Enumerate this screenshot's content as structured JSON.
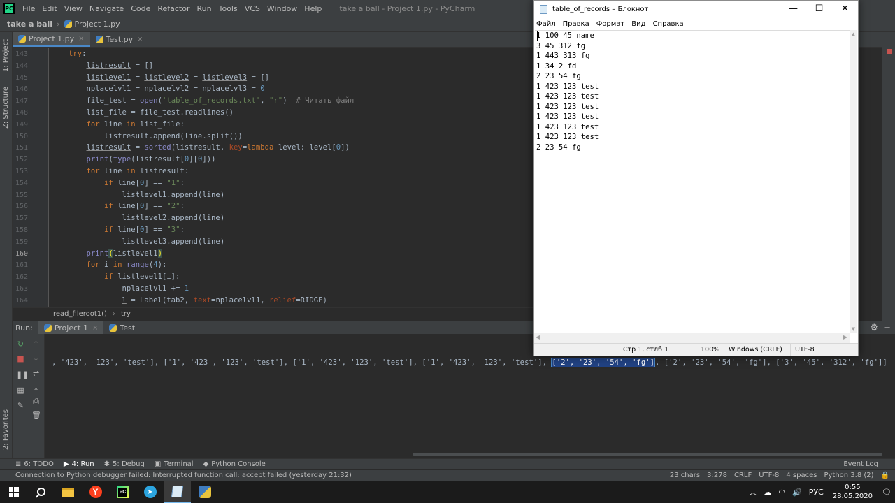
{
  "ide": {
    "logo": "PC",
    "menu": [
      "File",
      "Edit",
      "View",
      "Navigate",
      "Code",
      "Refactor",
      "Run",
      "Tools",
      "VCS",
      "Window",
      "Help"
    ],
    "window_title": "take a ball - Project 1.py - PyCharm",
    "breadcrumb": {
      "project": "take a ball",
      "file": "Project 1.py"
    },
    "tabs": [
      {
        "label": "Project 1.py",
        "close": "×"
      },
      {
        "label": "Test.py",
        "close": "×"
      }
    ],
    "side_labels": {
      "project": "1: Project",
      "structure": "Z: Structure",
      "favorites": "2: Favorites"
    },
    "code_breadcrumb": {
      "func": "read_fileroot1()",
      "block": "try"
    }
  },
  "code_lines": [
    {
      "n": "143",
      "indent": 0,
      "html": "<span class=\"kw\">try</span>:"
    },
    {
      "n": "144",
      "indent": 1,
      "html": "<span class=\"ul\">listresult</span> = []"
    },
    {
      "n": "145",
      "indent": 1,
      "html": "<span class=\"ul\">listlevel1</span> = <span class=\"ul\">listlevel2</span> = <span class=\"ul\">listlevel3</span> = []"
    },
    {
      "n": "146",
      "indent": 1,
      "html": "<span class=\"ul\">nplacelvl1</span> = <span class=\"ul\">nplacelvl2</span> = <span class=\"ul\">nplacelvl3</span> = <span class=\"nm\">0</span>"
    },
    {
      "n": "147",
      "indent": 1,
      "html": "file_test = <span class=\"bi\">open</span>(<span class=\"st\">'table_of_records.txt'</span>, <span class=\"st\">\"r\"</span>)  <span class=\"cm\"># Читать файл</span>"
    },
    {
      "n": "148",
      "indent": 1,
      "html": "list_file = file_test.readlines()"
    },
    {
      "n": "149",
      "indent": 1,
      "html": "<span class=\"kw\">for</span> line <span class=\"kw\">in</span> list_file:"
    },
    {
      "n": "150",
      "indent": 2,
      "html": "listresult.append(line.split())"
    },
    {
      "n": "151",
      "indent": 1,
      "html": "<span class=\"ul\">listresult</span> = <span class=\"bi\">sorted</span>(listresult, <span class=\"pa\">key</span>=<span class=\"kw\">lambda</span> level: level[<span class=\"nm\">0</span>])"
    },
    {
      "n": "152",
      "indent": 1,
      "html": "<span class=\"bi\">print</span>(<span class=\"bi\">type</span>(listresult[<span class=\"nm\">0</span>][<span class=\"nm\">0</span>]))"
    },
    {
      "n": "153",
      "indent": 1,
      "html": "<span class=\"kw\">for</span> line <span class=\"kw\">in</span> listresult:"
    },
    {
      "n": "154",
      "indent": 2,
      "html": "<span class=\"kw\">if</span> line[<span class=\"nm\">0</span>] == <span class=\"st\">\"1\"</span>:"
    },
    {
      "n": "155",
      "indent": 3,
      "html": "listlevel1.append(line)"
    },
    {
      "n": "156",
      "indent": 2,
      "html": "<span class=\"kw\">if</span> line[<span class=\"nm\">0</span>] == <span class=\"st\">\"2\"</span>:"
    },
    {
      "n": "157",
      "indent": 3,
      "html": "listlevel2.append(line)"
    },
    {
      "n": "158",
      "indent": 2,
      "html": "<span class=\"kw\">if</span> line[<span class=\"nm\">0</span>] == <span class=\"st\">\"3\"</span>:"
    },
    {
      "n": "159",
      "indent": 3,
      "html": "listlevel3.append(line)"
    },
    {
      "n": "160",
      "indent": 1,
      "html": "<span class=\"bi\">print</span><span class=\"hl\">(</span>listlevel1<span class=\"hl\">)</span>",
      "current": true
    },
    {
      "n": "161",
      "indent": 1,
      "html": "<span class=\"kw\">for</span> i <span class=\"kw\">in</span> <span class=\"bi\">range</span>(<span class=\"nm\">4</span>):"
    },
    {
      "n": "162",
      "indent": 2,
      "html": "<span class=\"kw\">if</span> listlevel1[i]:"
    },
    {
      "n": "163",
      "indent": 3,
      "html": "nplacelvl1 += <span class=\"nm\">1</span>"
    },
    {
      "n": "164",
      "indent": 3,
      "html": "<span class=\"ul\">l</span> = Label(tab2, <span class=\"pa\">text</span>=nplacelvl1, <span class=\"pa\">relief</span>=RIDGE)"
    }
  ],
  "run": {
    "label": "Run:",
    "tabs": [
      {
        "label": "Project 1",
        "close": "×"
      },
      {
        "label": "Test"
      }
    ],
    "output_before": ", '423', '123', 'test'], ['1', '423', '123', 'test'], ['1', '423', '123', 'test'], ['1', '423', '123', 'test'], ",
    "output_selected": "['2', '23', '54', 'fg']",
    "output_after": ", ['2', '23', '54', 'fg'], ['3', '45', '312', 'fg']]"
  },
  "toolwindows": [
    {
      "label": "6: TODO",
      "icon": "todo-icon",
      "glyph": "≣"
    },
    {
      "label": "4: Run",
      "icon": "run-icon",
      "glyph": "▶",
      "active": true
    },
    {
      "label": "5: Debug",
      "icon": "bug-icon",
      "glyph": "✱"
    },
    {
      "label": "Terminal",
      "icon": "terminal-icon",
      "glyph": "▣"
    },
    {
      "label": "Python Console",
      "icon": "python-console-icon",
      "glyph": "◆"
    }
  ],
  "event_log": "Event Log",
  "status": {
    "message": "Connection to Python debugger failed: Interrupted function call: accept failed (yesterday 21:32)",
    "chars": "23 chars",
    "position": "3:278",
    "line_sep": "CRLF",
    "encoding": "UTF-8",
    "indent": "4 spaces",
    "interpreter": "Python 3.8 (2)"
  },
  "notepad": {
    "title": "table_of_records – Блокнот",
    "menu": [
      "Файл",
      "Правка",
      "Формат",
      "Вид",
      "Справка"
    ],
    "lines": [
      "1 100 45 name",
      "3 45 312 fg",
      "1 443 313 fg",
      "1 34 2 fd",
      "2 23 54 fg",
      "1 423 123 test",
      "1 423 123 test",
      "1 423 123 test",
      "1 423 123 test",
      "1 423 123 test",
      "1 423 123 test",
      "2 23 54 fg"
    ],
    "status": {
      "cursor": "Стр 1, стлб 1",
      "zoom": "100%",
      "eol": "Windows (CRLF)",
      "encoding": "UTF-8"
    }
  },
  "taskbar": {
    "lang": "РУС",
    "time": "0:55",
    "date": "28.05.2020"
  },
  "colors": {
    "ide_bg": "#2b2b2b",
    "ide_panel": "#3c3f41",
    "selection": "#214283",
    "taskbar": "#1b1b1b"
  }
}
